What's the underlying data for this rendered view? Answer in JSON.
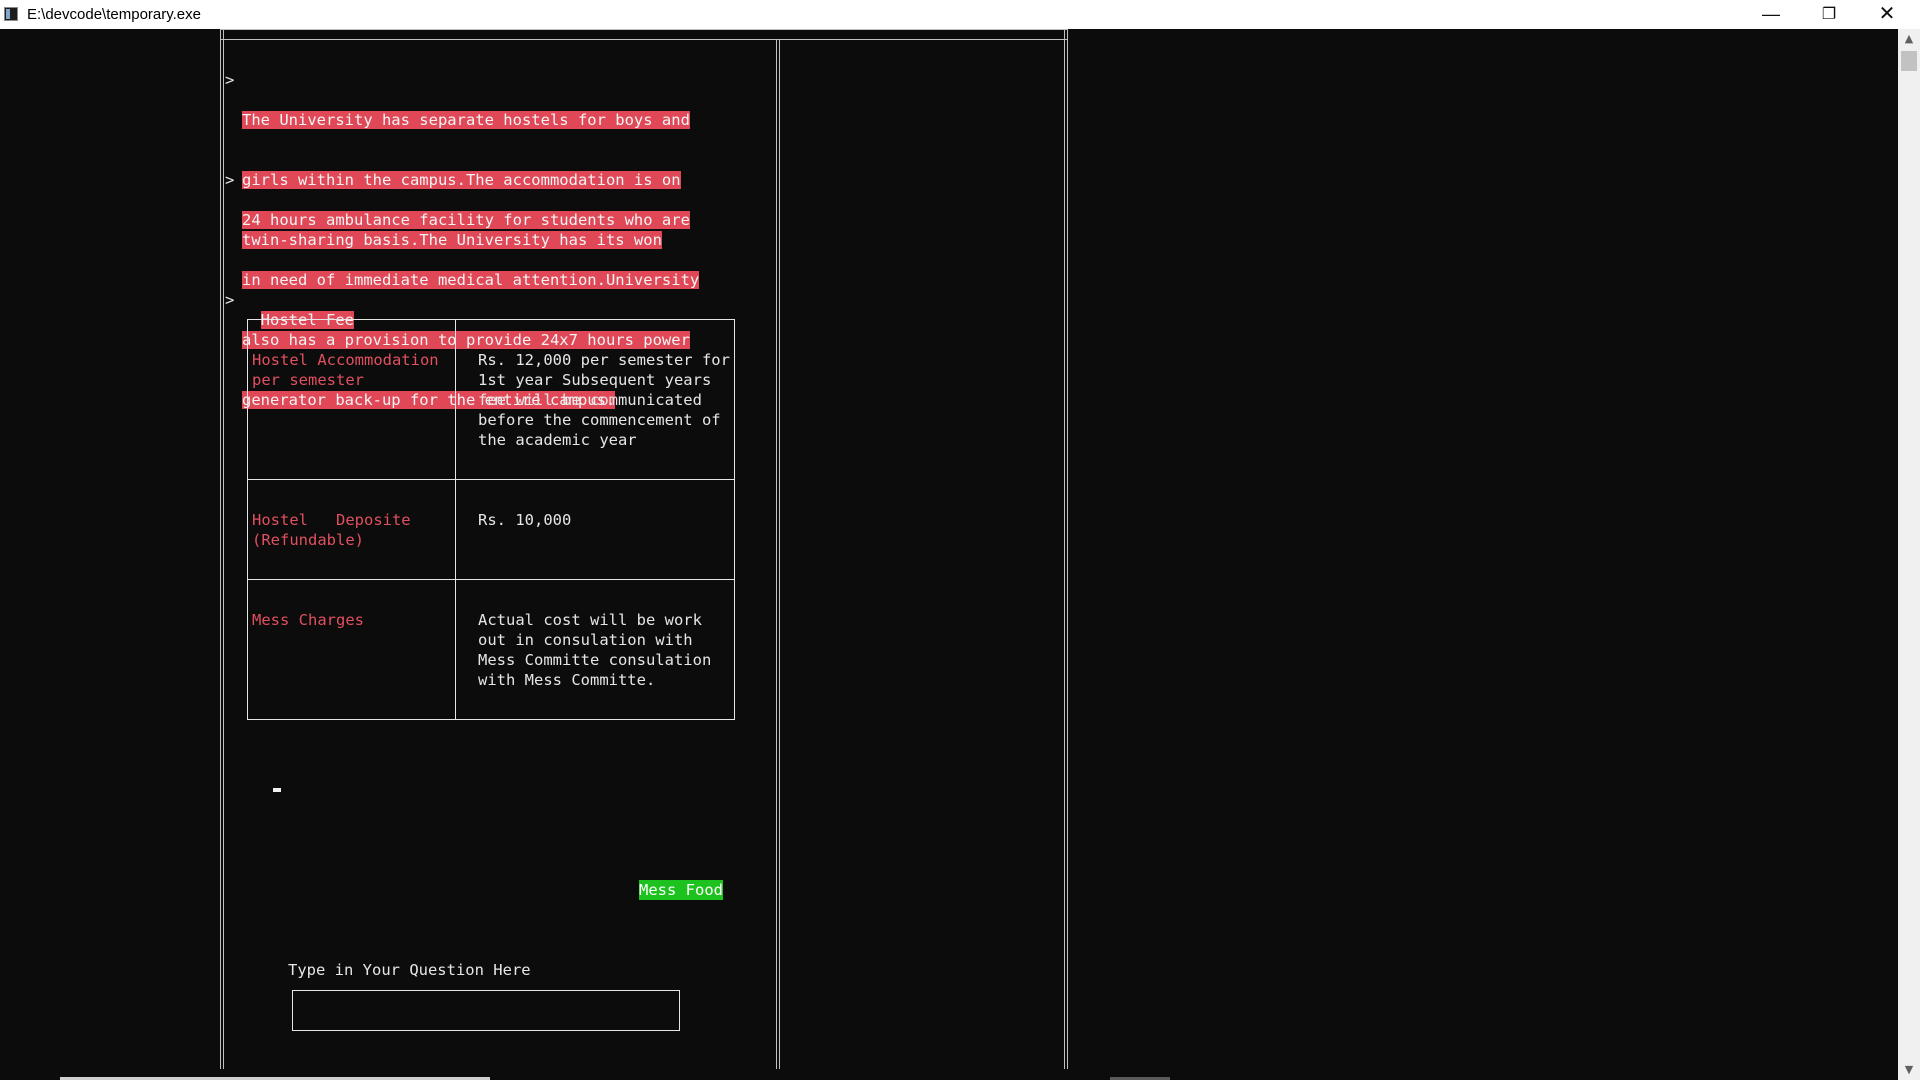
{
  "window": {
    "title": "E:\\devcode\\temporary.exe",
    "minimize_glyph": "—",
    "maximize_glyph": "❐",
    "close_glyph": "✕"
  },
  "content": {
    "bullet": ">",
    "paragraphs": [
      {
        "lines": [
          "The University has separate hostels for boys and",
          "girls within the campus.The accommodation is on",
          "twin-sharing basis.The University has its won"
        ]
      },
      {
        "lines": [
          "24 hours ambulance facility for students who are",
          "in need of immediate medical attention.University",
          "also has a provision to provide 24x7 hours power",
          "generator back-up for the entire campus."
        ]
      },
      {
        "lines": [
          "Hostel Fee"
        ]
      }
    ],
    "fee_table": [
      {
        "key": "Hostel Accommodation\nper semester",
        "value": "Rs. 12,000 per semester for\n1st year Subsequent years\nfee will be communicated\nbefore the commencement of\nthe academic year"
      },
      {
        "key": "Hostel   Deposite\n(Refundable)",
        "value": "Rs. 10,000"
      },
      {
        "key": "Mess Charges",
        "value": "Actual cost will be work\nout in consulation with\nMess Committe consulation\nwith Mess Committe."
      }
    ],
    "mess_food_label": "Mess Food",
    "question_label": "Type in Your Question Here",
    "question_value": ""
  },
  "colors": {
    "highlight": "#e04857",
    "key_text": "#e05060",
    "mess_food_bg": "#1ec21e",
    "background": "#0c0c0c"
  },
  "icons": {
    "app": "console-app-icon",
    "scroll_up": "chevron-up-icon",
    "scroll_down": "chevron-down-icon"
  }
}
